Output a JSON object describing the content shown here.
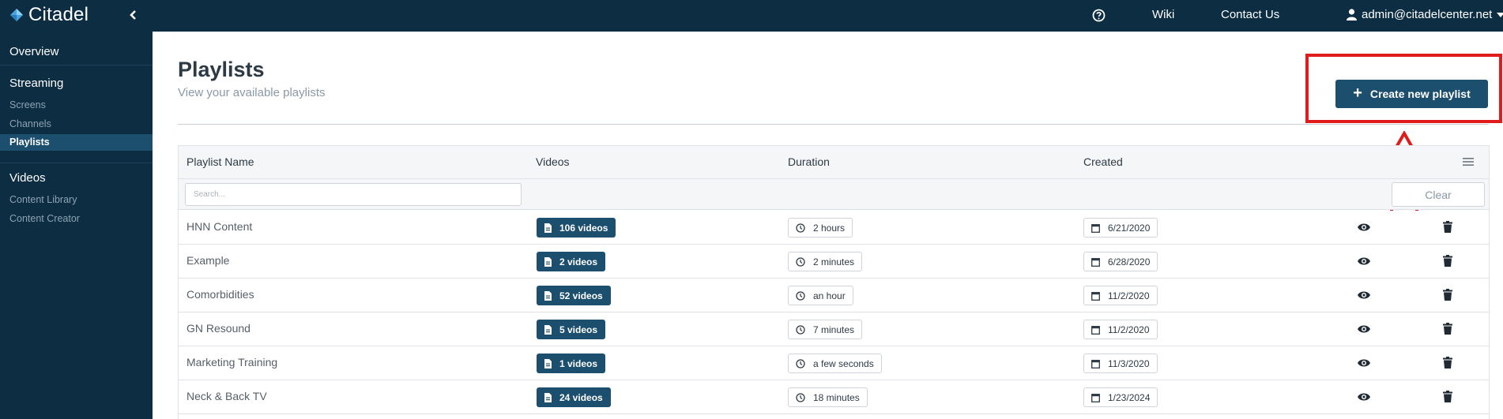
{
  "app": {
    "name": "Citadel",
    "collapse_icon": "chevron-left-icon"
  },
  "topnav": {
    "help_icon": "question-circle-icon",
    "wiki": "Wiki",
    "contact": "Contact Us",
    "user": "admin@citadelcenter.net",
    "user_icon": "user-icon",
    "caret_icon": "caret-down-icon"
  },
  "sidebar": {
    "overview": "Overview",
    "streaming": "Streaming",
    "screens": "Screens",
    "channels": "Channels",
    "playlists": "Playlists",
    "videos": "Videos",
    "content_library": "Content Library",
    "content_creator": "Content Creator"
  },
  "page": {
    "title": "Playlists",
    "subtitle": "View your available playlists",
    "create_label": "Create new playlist"
  },
  "table": {
    "columns": [
      "Playlist Name",
      "Videos",
      "Duration",
      "Created"
    ],
    "search_placeholder": "Search...",
    "clear_label": "Clear",
    "rows": [
      {
        "name": "HNN Content",
        "videos": "106 videos",
        "duration": "2 hours",
        "created": "6/21/2020"
      },
      {
        "name": "Example",
        "videos": "2 videos",
        "duration": "2 minutes",
        "created": "6/28/2020"
      },
      {
        "name": "Comorbidities",
        "videos": "52 videos",
        "duration": "an hour",
        "created": "11/2/2020"
      },
      {
        "name": "GN Resound",
        "videos": "5 videos",
        "duration": "7 minutes",
        "created": "11/2/2020"
      },
      {
        "name": "Marketing Training",
        "videos": "1 videos",
        "duration": "a few seconds",
        "created": "11/3/2020"
      },
      {
        "name": "Neck & Back TV",
        "videos": "24 videos",
        "duration": "18 minutes",
        "created": "1/23/2024"
      }
    ]
  },
  "colors": {
    "navy": "#0c2d42",
    "accent": "#1c4f6e",
    "highlight": "#e01b1b"
  }
}
